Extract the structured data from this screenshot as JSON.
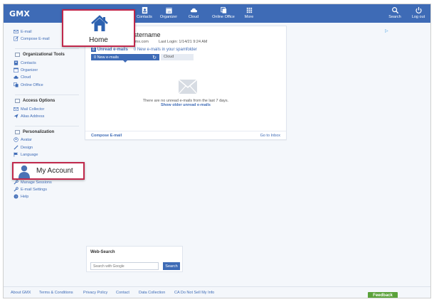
{
  "brand": {
    "logo": "GMX"
  },
  "nav": {
    "contacts": "Contacts",
    "organizer": "Organizer",
    "organizer_day": "15",
    "cloud": "Cloud",
    "online_office": "Online Office",
    "more": "More",
    "search": "Search",
    "logout": "Log out"
  },
  "sidebar": {
    "email": "E-mail",
    "compose": "Compose E-mail",
    "org_tools_head": "Organizational Tools",
    "contacts": "Contacts",
    "organizer": "Organizer",
    "cloud": "Cloud",
    "online_office": "Online Office",
    "access_head": "Access Options",
    "mail_collector": "Mail Collector",
    "alias": "Alias Address",
    "personal_head": "Personalization",
    "avatar": "Avatar",
    "design": "Design",
    "language": "Language",
    "manage_sessions": "Manage Sessions",
    "email_settings": "E-mail Settings",
    "help": "Help"
  },
  "callouts": {
    "home": "Home",
    "account": "My Account"
  },
  "card": {
    "name": "lustername",
    "email": "@gmx.com",
    "last_login": "Last Login: 1/14/21 9:24 AM",
    "unread_count": "0",
    "unread_label": "Unread e-mails",
    "spam_count": "0",
    "spam_label": "New e-mails in your spamfolder",
    "tab_new_count": "0",
    "tab_new_label": "New e-mails",
    "tab_cloud": "Cloud",
    "empty_msg": "There are no unread e-mails from the last 7 days.",
    "empty_link": "Show older unread e-mails",
    "compose": "Compose E-mail",
    "go_inbox": "Go to Inbox"
  },
  "websearch": {
    "title": "Web-Search",
    "placeholder": "Search with Google",
    "button": "Search"
  },
  "footer": {
    "about": "About GMX",
    "terms": "Terms & Conditions",
    "privacy": "Privacy Policy",
    "contact": "Contact",
    "data": "Data Collection",
    "ca": "CA Do Not Sell My Info",
    "feedback": "Feedback"
  },
  "colors": {
    "brand_blue": "#3e6bb6",
    "highlight": "#c0284b",
    "feedback_green": "#5aa23a"
  }
}
